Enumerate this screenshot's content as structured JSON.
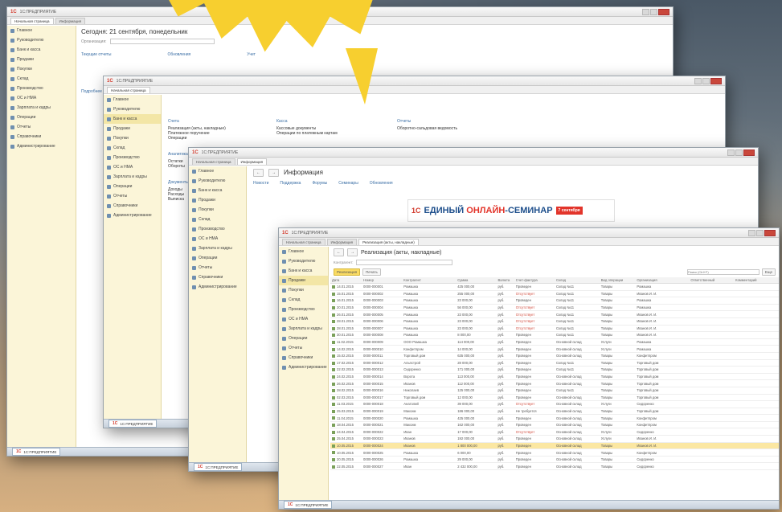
{
  "colors": {
    "accent": "#f7cf2f",
    "sidebar": "#fbf5d8",
    "link": "#3a6ea5",
    "selected_row": "#fbe7a2",
    "warning_text": "#d14a3c"
  },
  "window1": {
    "title": "1С:ПРЕДПРИЯТИЕ",
    "tabs": [
      "Начальная страница",
      "Информация"
    ],
    "sidebar": [
      "Главное",
      "Руководителю",
      "Банк и касса",
      "Продажи",
      "Покупки",
      "Склад",
      "Производство",
      "ОС и НМА",
      "Зарплата и кадры",
      "Операции",
      "Отчеты",
      "Справочники",
      "Администрирование"
    ],
    "heading": "Сегодня: 21 сентября, понедельник",
    "org_label": "Организация:",
    "col_headers": [
      "Текущие отчеты",
      "Обновления",
      "Учет"
    ],
    "help_link": "Подробнее"
  },
  "window2": {
    "title": "1С:ПРЕДПРИЯТИЕ",
    "tabs": [
      "Начальная страница"
    ],
    "sidebar": [
      "Главное",
      "Руководителю",
      "Банк и касса",
      "Продажи",
      "Покупки",
      "Склад",
      "Производство",
      "ОС и НМА",
      "Зарплата и кадры",
      "Операции",
      "Отчеты",
      "Справочники",
      "Администрирование"
    ],
    "groups": [
      {
        "title": "Счета",
        "items": [
          "Реализация (акты, накладные)",
          "Платежное поручение",
          "Операции"
        ]
      },
      {
        "title": "Касса",
        "items": [
          "Кассовые документы",
          "Операции по платежным картам"
        ]
      },
      {
        "title": "Отчеты",
        "items": [
          "Оборотно-сальдовая ведомость"
        ]
      }
    ],
    "sub_groups": [
      {
        "title": "Аналитика",
        "items": [
          "Остатки",
          "Обороты"
        ]
      },
      {
        "title": "Документы",
        "items": [
          "Доходы",
          "Расходы",
          "Выписка"
        ]
      }
    ]
  },
  "window3": {
    "title": "1С:ПРЕДПРИЯТИЕ",
    "tabs": [
      "Начальная страница",
      "Информация"
    ],
    "sidebar": [
      "Главное",
      "Руководителю",
      "Банк и касса",
      "Продажи",
      "Покупки",
      "Склад",
      "Производство",
      "ОС и НМА",
      "Зарплата и кадры",
      "Операции",
      "Отчеты",
      "Справочники",
      "Администрирование"
    ],
    "heading": "Информация",
    "links": [
      "Новости",
      "Поддержка",
      "Форумы",
      "Семинары",
      "Обновления"
    ],
    "banner": {
      "prefix": "ЕДИНЫЙ ",
      "accent": "ОНЛАЙН",
      "suffix": "-СЕМИНАР",
      "badge": "7 сентября"
    }
  },
  "window4": {
    "title": "1С:ПРЕДПРИЯТИЕ",
    "tabs": [
      "Начальная страница",
      "Информация",
      "Реализация (акты, накладные)"
    ],
    "sidebar": [
      "Главное",
      "Руководителю",
      "Банк и касса",
      "Продажи",
      "Покупки",
      "Склад",
      "Производство",
      "ОС и НМА",
      "Зарплата и кадры",
      "Операции",
      "Отчеты",
      "Справочники",
      "Администрирование"
    ],
    "heading": "Реализация (акты, накладные)",
    "toolbar": {
      "create": "Реализация",
      "print": "Печать",
      "more": "Еще",
      "search_placeholder": "Поиск (Ctrl+F)"
    },
    "filter_label": "Контрагент:",
    "columns": [
      "Дата",
      "Номер",
      "Контрагент",
      "Сумма",
      "Валюта",
      "Счет-фактура",
      "Склад",
      "Вид операции",
      "Организация",
      "Ответственный",
      "Комментарий"
    ],
    "rows": [
      [
        "14.01.2015",
        "0000-000001",
        "Ромашка",
        "425 000,00",
        "руб.",
        "Проведен",
        "Склад №11",
        "Товары",
        "Ромашка",
        "",
        ""
      ],
      [
        "15.01.2015",
        "0000-000002",
        "Ромашка",
        "255 000,00",
        "руб.",
        "Отсутствует",
        "Склад №11",
        "Товары",
        "Иванов И. И.",
        "",
        ""
      ],
      [
        "16.01.2015",
        "0000-000003",
        "Ромашка",
        "23 000,00",
        "руб.",
        "Проведен",
        "Склад №11",
        "Товары",
        "Ромашка",
        "",
        ""
      ],
      [
        "20.01.2015",
        "0000-000004",
        "Ромашка",
        "56 000,00",
        "руб.",
        "Отсутствует",
        "Склад №11",
        "Товары",
        "Ромашка",
        "",
        ""
      ],
      [
        "26.01.2015",
        "0000-000005",
        "Ромашка",
        "23 000,00",
        "руб.",
        "Отсутствует",
        "Склад №11",
        "Товары",
        "Иванов И. И.",
        "",
        ""
      ],
      [
        "28.01.2015",
        "0000-000006",
        "Ромашка",
        "23 000,00",
        "руб.",
        "Отсутствует",
        "Склад №11",
        "Товары",
        "Иванов И. И.",
        "",
        ""
      ],
      [
        "28.01.2015",
        "0000-000007",
        "Ромашка",
        "23 000,00",
        "руб.",
        "Отсутствует",
        "Склад №11",
        "Товары",
        "Иванов И. И.",
        "",
        ""
      ],
      [
        "30.01.2015",
        "0000-000008",
        "Ромашка",
        "8 000,00",
        "руб.",
        "Проведен",
        "Склад №11",
        "Товары",
        "Иванов И. И.",
        "",
        ""
      ],
      [
        "11.02.2015",
        "0000-000009",
        "ООО Ромашка",
        "114 000,00",
        "руб.",
        "Проведен",
        "Основной склад",
        "Услуги",
        "Ромашка",
        "",
        ""
      ],
      [
        "14.02.2015",
        "0000-000010",
        "Конфетпром",
        "14 000,00",
        "руб.",
        "Проведен",
        "Основной склад",
        "Услуги",
        "Ромашка",
        "",
        ""
      ],
      [
        "15.02.2015",
        "0000-000011",
        "Торговый дом",
        "635 000,00",
        "руб.",
        "Проведен",
        "Основной склад",
        "Товары",
        "Конфетпром",
        "",
        ""
      ],
      [
        "17.02.2015",
        "0000-000012",
        "Альпстрой",
        "28 000,00",
        "руб.",
        "Проведен",
        "Склад №11",
        "Товары",
        "Торговый дом",
        "",
        ""
      ],
      [
        "22.02.2015",
        "0000-000013",
        "Сидоренко",
        "171 000,00",
        "руб.",
        "Проведен",
        "Склад №11",
        "Товары",
        "Торговый дом",
        "",
        ""
      ],
      [
        "24.02.2015",
        "0000-000014",
        "Ворота",
        "113 000,00",
        "руб.",
        "Проведен",
        "Основной склад",
        "Товары",
        "Торговый дом",
        "",
        ""
      ],
      [
        "26.02.2015",
        "0000-000015",
        "Иванов",
        "112 000,00",
        "руб.",
        "Проведен",
        "Основной склад",
        "Товары",
        "Торговый дом",
        "",
        ""
      ],
      [
        "28.02.2015",
        "0000-000016",
        "Николаев",
        "125 000,00",
        "руб.",
        "Проведен",
        "Склад №11",
        "Товары",
        "Торговый дом",
        "",
        ""
      ],
      [
        "02.03.2015",
        "0000-000017",
        "Торговый дом",
        "12 000,00",
        "руб.",
        "Проведен",
        "Основной склад",
        "Товары",
        "Торговый дом",
        "",
        ""
      ],
      [
        "11.03.2015",
        "0000-000018",
        "Анатолий",
        "39 000,00",
        "руб.",
        "Отсутствует",
        "Основной склад",
        "Услуги",
        "Сидоренко",
        "",
        ""
      ],
      [
        "25.03.2015",
        "0000-000019",
        "Максим",
        "186 000,00",
        "руб.",
        "Не требуется",
        "Основной склад",
        "Товары",
        "Торговый дом",
        "",
        ""
      ],
      [
        "11.04.2015",
        "0000-000020",
        "Ромашка",
        "425 000,00",
        "руб.",
        "Проведен",
        "Основной склад",
        "Товары",
        "Конфетпром",
        "",
        ""
      ],
      [
        "18.04.2015",
        "0000-000021",
        "Максим",
        "162 000,00",
        "руб.",
        "Проведен",
        "Основной склад",
        "Товары",
        "Конфетпром",
        "",
        ""
      ],
      [
        "24.04.2015",
        "0000-000022",
        "Иван",
        "17 000,00",
        "руб.",
        "Отсутствует",
        "Основной склад",
        "Услуги",
        "Сидоренко",
        "",
        ""
      ],
      [
        "25.04.2015",
        "0000-000023",
        "Иванов",
        "192 000,00",
        "руб.",
        "Проведен",
        "Основной склад",
        "Услуги",
        "Иванов И. И.",
        "",
        ""
      ],
      [
        "10.05.2015",
        "0000-000024",
        "Иванов",
        "1 800 000,00",
        "руб.",
        "Проведен",
        "Основной склад",
        "Товары",
        "Иванов И. И.",
        "",
        ""
      ],
      [
        "10.05.2015",
        "0000-000025",
        "Ромашка",
        "6 000,00",
        "руб.",
        "Проведен",
        "Основной склад",
        "Товары",
        "Конфетпром",
        "",
        ""
      ],
      [
        "20.05.2015",
        "0000-000026",
        "Ромашка",
        "29 000,00",
        "руб.",
        "Проведен",
        "Основной склад",
        "Товары",
        "Сидоренко",
        "",
        ""
      ],
      [
        "22.05.2015",
        "0000-000027",
        "Иван",
        "2 432 000,00",
        "руб.",
        "Проведен",
        "Основной склад",
        "Товары",
        "Сидоренко",
        "",
        ""
      ]
    ],
    "selected_row": 23,
    "taskbar_item": "1С:ПРЕДПРИЯТИЕ"
  },
  "taskbar_item": "1С:ПРЕДПРИЯТИЕ"
}
